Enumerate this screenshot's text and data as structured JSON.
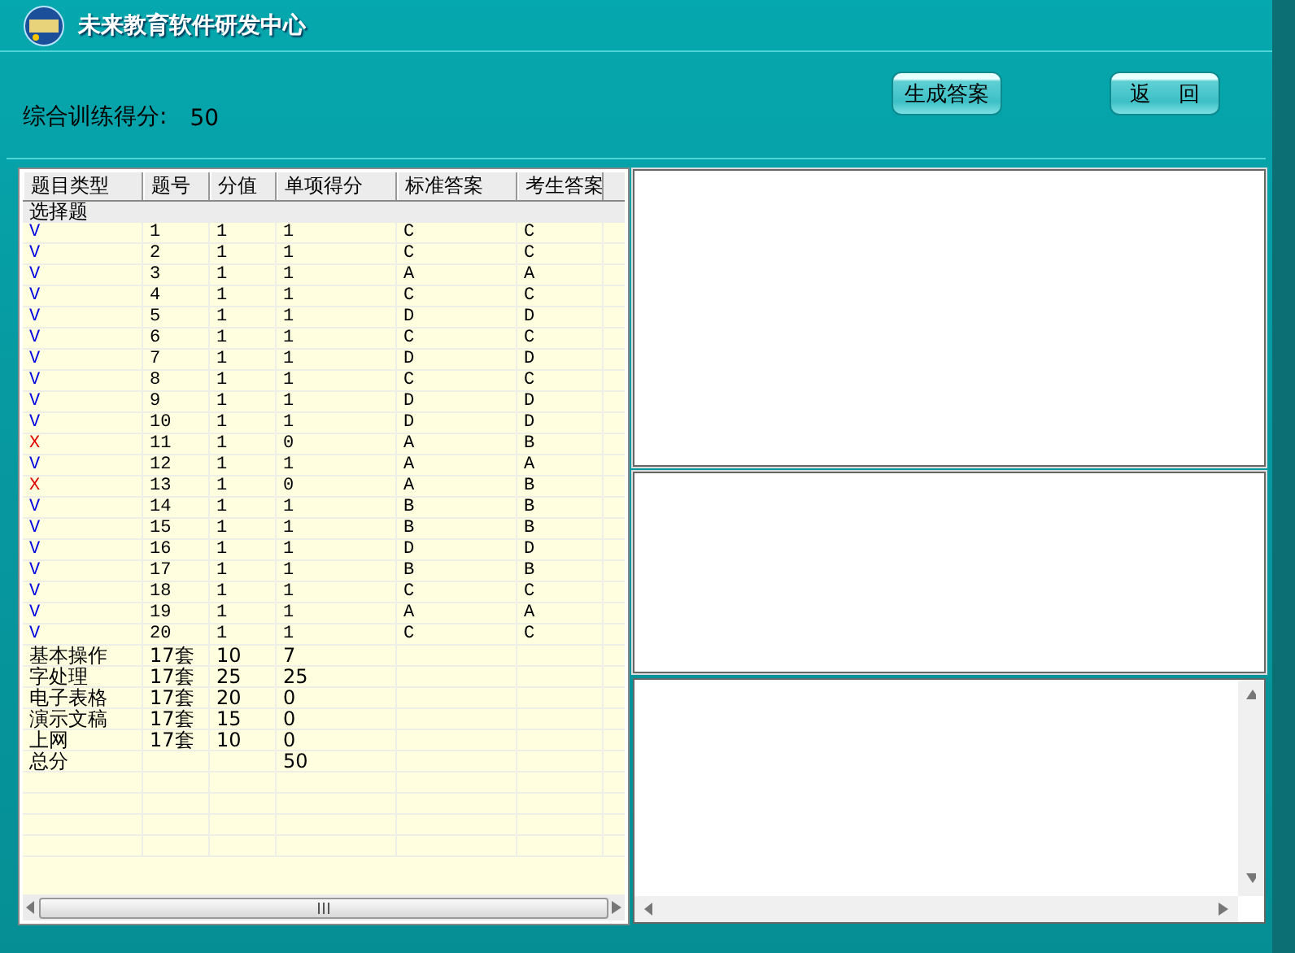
{
  "window": {
    "title": "未来教育软件研发中心"
  },
  "score": {
    "label": "综合训练得分:",
    "value": "50"
  },
  "buttons": [
    "生成答案",
    "返    回"
  ],
  "table": {
    "columns": [
      "题目类型",
      "题号",
      "分值",
      "单项得分",
      "标准答案",
      "考生答案"
    ],
    "section": "选择题",
    "rows": [
      {
        "correct": true,
        "cells": [
          "V",
          "1",
          "1",
          "1",
          "C",
          "C"
        ]
      },
      {
        "correct": true,
        "cells": [
          "V",
          "2",
          "1",
          "1",
          "C",
          "C"
        ]
      },
      {
        "correct": true,
        "cells": [
          "V",
          "3",
          "1",
          "1",
          "A",
          "A"
        ]
      },
      {
        "correct": true,
        "cells": [
          "V",
          "4",
          "1",
          "1",
          "C",
          "C"
        ]
      },
      {
        "correct": true,
        "cells": [
          "V",
          "5",
          "1",
          "1",
          "D",
          "D"
        ]
      },
      {
        "correct": true,
        "cells": [
          "V",
          "6",
          "1",
          "1",
          "C",
          "C"
        ]
      },
      {
        "correct": true,
        "cells": [
          "V",
          "7",
          "1",
          "1",
          "D",
          "D"
        ]
      },
      {
        "correct": true,
        "cells": [
          "V",
          "8",
          "1",
          "1",
          "C",
          "C"
        ]
      },
      {
        "correct": true,
        "cells": [
          "V",
          "9",
          "1",
          "1",
          "D",
          "D"
        ]
      },
      {
        "correct": true,
        "cells": [
          "V",
          "10",
          "1",
          "1",
          "D",
          "D"
        ]
      },
      {
        "correct": false,
        "cells": [
          "X",
          "11",
          "1",
          "0",
          "A",
          "B"
        ]
      },
      {
        "correct": true,
        "cells": [
          "V",
          "12",
          "1",
          "1",
          "A",
          "A"
        ]
      },
      {
        "correct": false,
        "cells": [
          "X",
          "13",
          "1",
          "0",
          "A",
          "B"
        ]
      },
      {
        "correct": true,
        "cells": [
          "V",
          "14",
          "1",
          "1",
          "B",
          "B"
        ]
      },
      {
        "correct": true,
        "cells": [
          "V",
          "15",
          "1",
          "1",
          "B",
          "B"
        ]
      },
      {
        "correct": true,
        "cells": [
          "V",
          "16",
          "1",
          "1",
          "D",
          "D"
        ]
      },
      {
        "correct": true,
        "cells": [
          "V",
          "17",
          "1",
          "1",
          "B",
          "B"
        ]
      },
      {
        "correct": true,
        "cells": [
          "V",
          "18",
          "1",
          "1",
          "C",
          "C"
        ]
      },
      {
        "correct": true,
        "cells": [
          "V",
          "19",
          "1",
          "1",
          "A",
          "A"
        ]
      },
      {
        "correct": true,
        "cells": [
          "V",
          "20",
          "1",
          "1",
          "C",
          "C"
        ]
      }
    ],
    "summary": [
      {
        "cells": [
          "基本操作",
          "17套",
          "10",
          "7"
        ]
      },
      {
        "cells": [
          "字处理",
          "17套",
          "25",
          "25"
        ]
      },
      {
        "cells": [
          "电子表格",
          "17套",
          "20",
          "0"
        ]
      },
      {
        "cells": [
          "演示文稿",
          "17套",
          "15",
          "0"
        ]
      },
      {
        "cells": [
          "上网",
          "17套",
          "10",
          "0"
        ]
      },
      {
        "cells": [
          "总分",
          "",
          "",
          "50"
        ]
      }
    ]
  }
}
